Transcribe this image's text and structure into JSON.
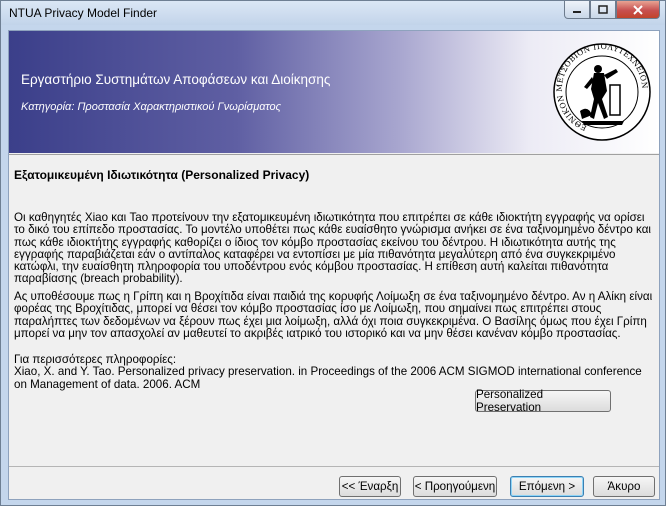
{
  "window": {
    "title": "NTUA Privacy Model Finder"
  },
  "banner": {
    "organization": "Εργαστήριο Συστημάτων Αποφάσεων και Διοίκησης",
    "category": "Κατηγορία: Προστασία Χαρακτηριστικού Γνωρίσματος",
    "logo_icon": "ntua-seal-logo",
    "logo_text": "ΕΘΝΙΚΟΝ ΜΕΤΣΟΒΙΟΝ ΠΟΛΥΤΕΧΝΕΙΟΝ"
  },
  "content": {
    "heading": "Εξατομικευμένη Ιδιωτικότητα (Personalized Privacy)",
    "paragraph1": "Οι καθηγητές Xiao και Tao προτείνουν την εξατομικευμένη ιδιωτικότητα που επιτρέπει σε κάθε ιδιοκτήτη εγγραφής να ορίσει το δικό του επίπεδο προστασίας. Το μοντέλο υποθέτει πως κάθε ευαίσθητο γνώρισμα ανήκει σε ένα ταξινομημένο δέντρο και πως κάθε ιδιοκτήτης εγγραφής καθορίζει ο ίδιος τον κόμβο προστασίας εκείνου του δέντρου. Η ιδιωτικότητα αυτής της εγγραφής παραβιάζεται εάν ο αντίπαλος καταφέρει να εντοπίσει με μία πιθανότητα μεγαλύτερη από ένα συγκεκριμένο κατώφλι, την ευαίσθητη πληροφορία του υποδέντρου ενός κόμβου προστασίας. Η επίθεση αυτή καλείται πιθανότητα παραβίασης (breach probability).",
    "paragraph2": "Ας υποθέσουμε πως η Γρίπη και η Βροχίτιδα είναι παιδιά της κορυφής Λοίμωξη σε ένα ταξινομημένο δέντρο. Αν η Αλίκη είναι φορέας της Βροχίτιδας, μπορεί να θέσει τον κόμβο προστασίας ίσο με Λοίμωξη, που σημαίνει πως επιτρέπει στους παραλήπτες των δεδομένων να ξέρουν πως έχει μια λοίμωξη, αλλά όχι ποια συγκεκριμένα. Ο Βασίλης όμως που έχει Γρίπη μπορεί να μην τον απασχολεί αν μαθευτεί το ακριβές ιατρικό του ιστορικό και να μην θέσει κανέναν κόμβο προστασίας.",
    "more_info_label": "Για περισσότερες πληροφορίες:",
    "reference": "Xiao, X. and Y. Tao. Personalized privacy preservation. in Proceedings of the 2006 ACM SIGMOD international conference on Management of data. 2006. ACM",
    "reference_button": "Personalized Preservation"
  },
  "footer": {
    "start": "<< Έναρξη",
    "previous": "< Προηγούμενη",
    "next": "Επόμενη >",
    "cancel": "Άκυρο"
  }
}
